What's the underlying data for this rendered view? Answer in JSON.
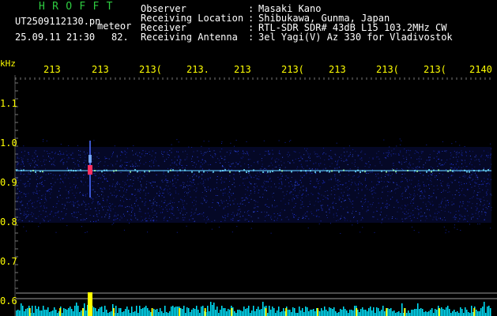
{
  "logo": "HROFFT",
  "file_name": "UT2509112130.pn",
  "tag": "meteor",
  "datetime": "25.09.11 21:30",
  "count": "82.",
  "info": [
    {
      "label": "Observer",
      "value": "Masaki Kano"
    },
    {
      "label": "Receiving Location",
      "value": "Shibukawa, Gunma, Japan"
    },
    {
      "label": "Receiver",
      "value": "RTL-SDR SDR# 43dB L15 103.2MHz CW"
    },
    {
      "label": "Receiving Antenna",
      "value": "3el Yagi(V) Az 330 for Vladivostok"
    }
  ],
  "colon": ":",
  "y_unit": "kHz",
  "x_ticks": [
    "213",
    "213",
    "213(",
    "213.",
    "213",
    "213(",
    "213",
    "213(",
    "213(",
    "2140"
  ],
  "y_ticks": [
    "1.1",
    "1.0",
    "0.9",
    "0.8",
    "0.7",
    "0.6"
  ],
  "colors": {
    "background": "#000000",
    "header_text": "#ffffff",
    "logo": "#2ecc40",
    "axis_text": "#ffff00",
    "noise_band": "#1a2ad0",
    "carrier": "#5fc8ff",
    "meteor_head": "#ff3060",
    "level_bars": "#00e5ff",
    "level_peak": "#ffff00"
  },
  "meteor_events": [
    {
      "minute": 2131.4,
      "note": "strong head echo near 0.93 kHz"
    }
  ]
}
